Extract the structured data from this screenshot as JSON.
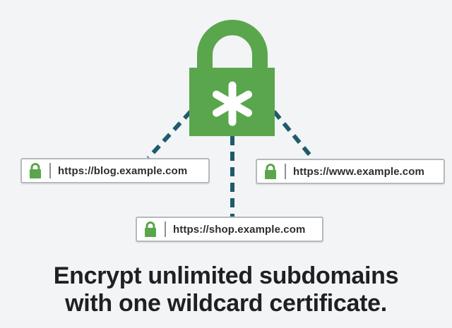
{
  "colors": {
    "lock_green": "#5aa64c",
    "connector": "#1f5b6d",
    "background": "#f3f4f6",
    "text": "#1e2022"
  },
  "center_lock": {
    "icon": "padlock-asterisk-icon"
  },
  "subdomains": [
    {
      "url": "https://blog.example.com",
      "icon": "lock-icon"
    },
    {
      "url": "https://www.example.com",
      "icon": "lock-icon"
    },
    {
      "url": "https://shop.example.com",
      "icon": "lock-icon"
    }
  ],
  "headline": {
    "line1": "Encrypt unlimited subdomains",
    "line2": "with one wildcard certificate."
  }
}
